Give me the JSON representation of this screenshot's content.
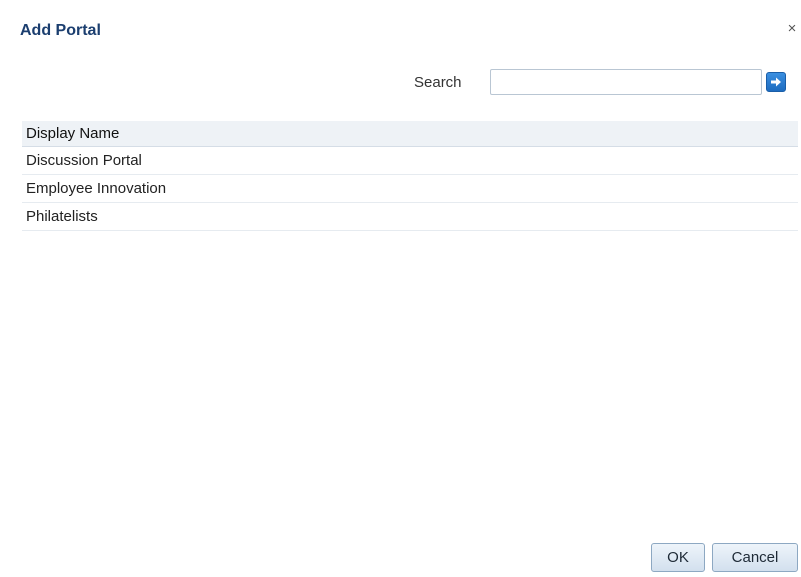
{
  "dialog": {
    "title": "Add Portal",
    "close_label": "×"
  },
  "search": {
    "label": "Search",
    "value": "",
    "placeholder": "",
    "go_icon": "arrow-right-icon",
    "accent_color": "#2878d0"
  },
  "table": {
    "header": "Display Name",
    "rows": [
      "Discussion Portal",
      "Employee Innovation",
      "Philatelists"
    ]
  },
  "footer": {
    "ok_label": "OK",
    "cancel_label": "Cancel"
  }
}
